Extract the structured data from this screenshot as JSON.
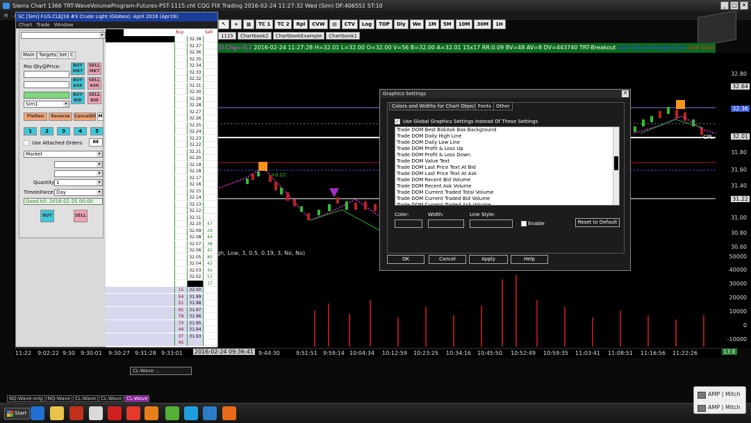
{
  "window": {
    "title": "Sierra Chart 1366 TRT-WaveVolumeProgram-Futures-PST-1115.cht   CQG FIX Trading 2016-02-24  11:27:32 Wed (Sim)  DF:406551  ST:10",
    "min": "_",
    "max": "□",
    "close": "✕"
  },
  "menubar": [
    "Fi",
    "Ac"
  ],
  "toolbar": [
    "TC 1",
    "TC 2",
    "Rpl",
    "CVW",
    "CTV",
    "Log",
    "TOP",
    "Dly",
    "We",
    "1M",
    "5M",
    "10M",
    "30M",
    "1H"
  ],
  "toolbar_icons": [
    "cursor-icon",
    "crosshair-icon",
    "grid-icon"
  ],
  "chart_tabs": [
    "1115",
    "Chartbook2",
    "ChartbookExample",
    "Chartbook1"
  ],
  "chart_header": {
    "prefix": "D.Chg=-0.1",
    "text": "2016-02-24 11:27:28 H=32.01 L=32.00 O=32.00 V=56 B=32.00 A=32.01 15x17 RR:0.09 BV=48 AV=8 DV=443740  TRT-Breakout",
    "blue": "Low Volume Range (Line",
    "red": "Line Color="
  },
  "chart_annotation": "gh, Low, 3, 0.5, 0.19, 3, No, No)",
  "chart_price_label": "+0.22",
  "chart_cpl_label": "CPL",
  "y_axis_labels": [
    "32.80",
    "32.64",
    "32.36",
    "32.01",
    "31.80",
    "31.60",
    "31.40",
    "31.22",
    "31.00",
    "30.80",
    "30.60",
    "50000",
    "40000",
    "30000",
    "20000",
    "10000",
    "0",
    "-10000"
  ],
  "x_axis_labels": [
    "11:22",
    "9:02:22",
    "9:30",
    "9:30:01",
    "9:30:27",
    "9:31:28",
    "9:33:01",
    "9:44:30",
    "9:51:51",
    "9:59:14",
    "10:04:34",
    "10:12:59",
    "10:23:25",
    "10:34:16",
    "10:45:50",
    "10:52:49",
    "10:59:35",
    "11:03:41",
    "11:08:51",
    "11:16:56",
    "11:22:26"
  ],
  "x_axis_cursor": "2016-02-24  09:36:41",
  "x_axis_corner": "13 E",
  "dom_window": {
    "title": "SC [Sim]  F.US.CLEJ16  #3  Crude Light (Globex): April 2016 (Apr16)",
    "menu": [
      "Chart",
      "Trade",
      "Window"
    ],
    "header_buy": "Buy",
    "header_sell": "Sell",
    "tabs": [
      "Main",
      "Targets",
      "Set",
      "C"
    ],
    "pos_qty_label": "Pos Qty@Price:",
    "buy_mkt": "BUY MKT",
    "sell_mkt": "SELL MKT",
    "buy_ask": "BUY ASK",
    "sell_ask": "SELL ASK",
    "buy_bid": "BUY BID",
    "sell_bid": "SELL BID",
    "account": "Sim1",
    "flatten": "Flatten",
    "reverse": "Reverse",
    "cancel_all": "CancelAll",
    "m": "M",
    "numbers": [
      "1",
      "2",
      "3",
      "4",
      "5"
    ],
    "use_attached": "Use Attached Orders",
    "be": "BE",
    "order_type": "Market",
    "quantity_label": "Quantity:",
    "quantity_value": "1",
    "tif_label": "TimeInForce:",
    "tif_value": "Day",
    "good_till": "Good till: 2016-02-25 00:00",
    "buy": "BUY",
    "sell": "SELL",
    "ladder": [
      {
        "price": "32.38",
        "buy": "",
        "sell": ""
      },
      {
        "price": "32.37",
        "buy": "",
        "sell": ""
      },
      {
        "price": "32.36",
        "buy": "",
        "sell": ""
      },
      {
        "price": "32.35",
        "buy": "",
        "sell": ""
      },
      {
        "price": "32.34",
        "buy": "",
        "sell": ""
      },
      {
        "price": "32.33",
        "buy": "",
        "sell": ""
      },
      {
        "price": "32.32",
        "buy": "",
        "sell": ""
      },
      {
        "price": "32.31",
        "buy": "",
        "sell": ""
      },
      {
        "price": "32.30",
        "buy": "",
        "sell": ""
      },
      {
        "price": "32.29",
        "buy": "",
        "sell": ""
      },
      {
        "price": "32.28",
        "buy": "",
        "sell": ""
      },
      {
        "price": "32.27",
        "buy": "",
        "sell": ""
      },
      {
        "price": "32.26",
        "buy": "",
        "sell": ""
      },
      {
        "price": "32.25",
        "buy": "",
        "sell": ""
      },
      {
        "price": "32.24",
        "buy": "",
        "sell": ""
      },
      {
        "price": "32.23",
        "buy": "",
        "sell": ""
      },
      {
        "price": "32.22",
        "buy": "",
        "sell": ""
      },
      {
        "price": "32.21",
        "buy": "",
        "sell": ""
      },
      {
        "price": "32.20",
        "buy": "",
        "sell": ""
      },
      {
        "price": "32.19",
        "buy": "",
        "sell": ""
      },
      {
        "price": "32.18",
        "buy": "",
        "sell": ""
      },
      {
        "price": "32.17",
        "buy": "",
        "sell": ""
      },
      {
        "price": "32.16",
        "buy": "",
        "sell": ""
      },
      {
        "price": "32.15",
        "buy": "",
        "sell": ""
      },
      {
        "price": "32.14",
        "buy": "",
        "sell": ""
      },
      {
        "price": "32.13",
        "buy": "",
        "sell": ""
      },
      {
        "price": "32.12",
        "buy": "",
        "sell": ""
      },
      {
        "price": "32.11",
        "buy": "",
        "sell": ""
      },
      {
        "price": "32.10",
        "buy": "",
        "sell": "47"
      },
      {
        "price": "32.09",
        "buy": "",
        "sell": "29"
      },
      {
        "price": "32.08",
        "buy": "",
        "sell": "44"
      },
      {
        "price": "32.07",
        "buy": "",
        "sell": "38"
      },
      {
        "price": "32.06",
        "buy": "",
        "sell": "42"
      },
      {
        "price": "32.05",
        "buy": "",
        "sell": "80"
      },
      {
        "price": "32.04",
        "buy": "",
        "sell": "42"
      },
      {
        "price": "32.03",
        "buy": "",
        "sell": "42"
      },
      {
        "price": "32.02",
        "buy": "",
        "sell": "53"
      },
      {
        "price": "",
        "buy": "",
        "sell": "17"
      },
      {
        "price": "32.00",
        "buy": "15",
        "sell": ""
      },
      {
        "price": "31.99",
        "buy": "54",
        "sell": ""
      },
      {
        "price": "31.98",
        "buy": "51",
        "sell": ""
      },
      {
        "price": "31.97",
        "buy": "65",
        "sell": ""
      },
      {
        "price": "31.96",
        "buy": "78",
        "sell": ""
      },
      {
        "price": "31.95",
        "buy": "73",
        "sell": ""
      },
      {
        "price": "31.94",
        "buy": "44",
        "sell": ""
      },
      {
        "price": "31.93",
        "buy": "37",
        "sell": ""
      },
      {
        "price": "",
        "buy": "45",
        "sell": ""
      }
    ]
  },
  "graphics_dialog": {
    "title": "Graphics Settings",
    "close": "✕",
    "tabs": [
      "Colors and Widths for Chart Objects",
      "Fonts",
      "Other"
    ],
    "use_global_checked": "✓",
    "use_global": "Use Global Graphics Settings Instead Of These Settings",
    "items": [
      "Trade DOM Best Bid/Ask Box Background",
      "Trade DOM Daily High Line",
      "Trade DOM Daily Low Line",
      "Trade DOM Profit & Loss Up",
      "Trade DOM Profit & Loss Down",
      "Trade DOM Value Text",
      "Trade DOM Last Price Text At Bid",
      "Trade DOM Last Price Text At Ask",
      "Trade DOM Recent Bid Volume",
      "Trade DOM Recent Ask Volume",
      "Trade DOM Current Traded Total Volume",
      "Trade DOM Current Traded Bid Volume",
      "Trade DOM Current Traded Ask Volume"
    ],
    "color_label": "Color:",
    "width_label": "Width:",
    "line_style_label": "Line Style:",
    "enable_label": "Enable",
    "reset_label": "Reset to Default",
    "ok": "OK",
    "cancel": "Cancel",
    "apply": "Apply",
    "help": "Help"
  },
  "wave_window": "CL-Wave ...",
  "sheet_tabs": [
    "NQ-Wave-orig",
    "NQ-Wave",
    "CL-Wave",
    "CL-Wave",
    "CL-Wave"
  ],
  "taskbar": {
    "start": "Start",
    "icons": [
      "ie-icon",
      "folder-icon",
      "media-player-icon",
      "stopwatch-icon",
      "checkmark-icon",
      "play-icon",
      "firefox-icon",
      "settings-icon",
      "skype-icon",
      "globe-icon",
      "bitcoin-icon"
    ],
    "notifications": [
      "AMP | Mitch",
      "AMP | Mitch"
    ]
  },
  "colors": {
    "header_green": "#0b6b1e",
    "buy_cyan": "#3fc7d9",
    "sell_pink": "#f0a0b4",
    "orange": "#f4a372",
    "title_blue": "#1b3d9a"
  }
}
